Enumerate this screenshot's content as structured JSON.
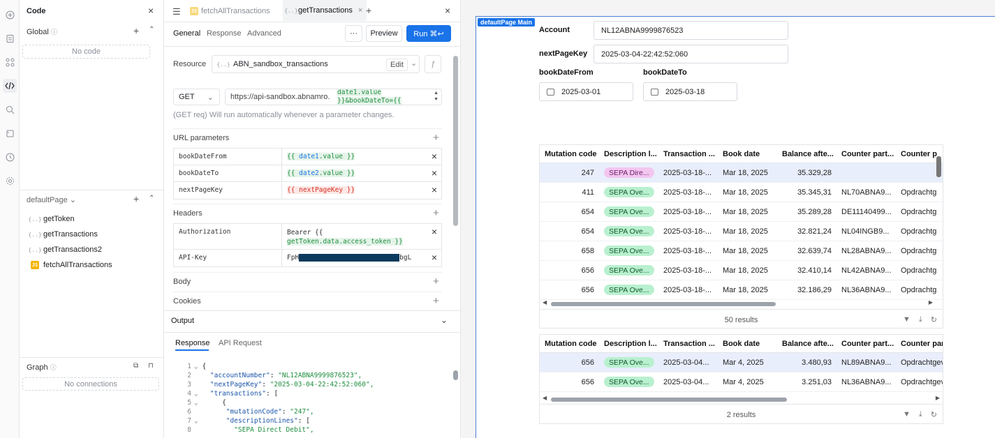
{
  "code_panel": {
    "title": "Code",
    "global_label": "Global",
    "no_code": "No code",
    "page_label": "defaultPage",
    "queries": [
      {
        "name": "getToken",
        "kind": "query"
      },
      {
        "name": "getTransactions",
        "kind": "query"
      },
      {
        "name": "getTransactions2",
        "kind": "query"
      },
      {
        "name": "fetchAllTransactions",
        "kind": "js"
      }
    ],
    "graph_label": "Graph",
    "no_connections": "No connections"
  },
  "editor": {
    "tabs": [
      {
        "label": "fetchAllTransactions",
        "icon": "JS"
      },
      {
        "label": "getTransactions",
        "icon": "{}"
      }
    ],
    "subtabs": [
      "General",
      "Response",
      "Advanced"
    ],
    "more": "···",
    "preview": "Preview",
    "run": "Run ⌘↩",
    "resource_label": "Resource",
    "resource_value": "ABN_sandbox_transactions",
    "edit": "Edit",
    "method": "GET",
    "url_prefix": "https://api-sandbox.abnamro.",
    "url_line1": "date1.value",
    "url_line2": "}}&bookDateTo={{",
    "hint": "(GET req) Will run automatically whenever a parameter changes.",
    "url_params_label": "URL parameters",
    "params": [
      {
        "key": "bookDateFrom",
        "value": "{{ date1.value }}"
      },
      {
        "key": "bookDateTo",
        "value": "{{ date2.value }}"
      },
      {
        "key": "nextPageKey",
        "value": "{{ nextPageKey }}"
      }
    ],
    "headers_label": "Headers",
    "headers": [
      {
        "key": "Authorization",
        "value_line1": "Bearer {{",
        "value_line2": "getToken.data.access_token }}"
      },
      {
        "key": "API-Key",
        "value_prefix": "FpH",
        "value_suffix": "bgL"
      }
    ],
    "body_label": "Body",
    "cookies_label": "Cookies"
  },
  "output": {
    "title": "Output",
    "tabs": [
      "Response",
      "API Request"
    ],
    "lines": [
      {
        "n": "1",
        "text": "{"
      },
      {
        "n": "2",
        "key": "\"accountNumber\"",
        "val": "\"NL12ABNA9999876523\","
      },
      {
        "n": "3",
        "key": "\"nextPageKey\"",
        "val": "\"2025-03-04-22:42:52:060\","
      },
      {
        "n": "4",
        "key": "\"transactions\"",
        "val": "["
      },
      {
        "n": "5",
        "text": "  {"
      },
      {
        "n": "6",
        "key": "\"mutationCode\"",
        "val": "\"247\","
      },
      {
        "n": "7",
        "key": "\"descriptionLines\"",
        "val": "["
      },
      {
        "n": "8",
        "val": "\"SEPA Direct Debit\","
      }
    ]
  },
  "canvas": {
    "frame_label": "defaultPage Main",
    "account_label": "Account",
    "account_value": "NL12ABNA9999876523",
    "nextpage_label": "nextPageKey",
    "nextpage_value": "2025-03-04-22:42:52:060",
    "from_label": "bookDateFrom",
    "from_value": "2025-03-01",
    "to_label": "bookDateTo",
    "to_value": "2025-03-18"
  },
  "table1": {
    "columns": [
      "Mutation code",
      "Description l...",
      "Transaction ...",
      "Book date",
      "Balance afte...",
      "Counter part...",
      "Counter p"
    ],
    "rows": [
      {
        "code": "247",
        "desc": "SEPA Dire...",
        "tag": "pink",
        "tx": "2025-03-18-...",
        "date": "Mar 18, 2025",
        "bal": "35.329,28",
        "cp": "",
        "cpn": ""
      },
      {
        "code": "411",
        "desc": "SEPA Ove...",
        "tag": "green",
        "tx": "2025-03-18-...",
        "date": "Mar 18, 2025",
        "bal": "35.345,31",
        "cp": "NL70ABNA9...",
        "cpn": "Opdrachtg"
      },
      {
        "code": "654",
        "desc": "SEPA Ove...",
        "tag": "green",
        "tx": "2025-03-18-...",
        "date": "Mar 18, 2025",
        "bal": "35.289,28",
        "cp": "DE11140499...",
        "cpn": "Opdrachtg"
      },
      {
        "code": "654",
        "desc": "SEPA Ove...",
        "tag": "green",
        "tx": "2025-03-18-...",
        "date": "Mar 18, 2025",
        "bal": "32.821,24",
        "cp": "NL04INGB9...",
        "cpn": "Opdrachtg"
      },
      {
        "code": "658",
        "desc": "SEPA Ove...",
        "tag": "green",
        "tx": "2025-03-18-...",
        "date": "Mar 18, 2025",
        "bal": "32.639,74",
        "cp": "NL28ABNA9...",
        "cpn": "Opdrachtg"
      },
      {
        "code": "656",
        "desc": "SEPA Ove...",
        "tag": "green",
        "tx": "2025-03-18-...",
        "date": "Mar 18, 2025",
        "bal": "32.410,14",
        "cp": "NL42ABNA9...",
        "cpn": "Opdrachtg"
      },
      {
        "code": "656",
        "desc": "SEPA Ove...",
        "tag": "green",
        "tx": "2025-03-18-...",
        "date": "Mar 18, 2025",
        "bal": "32.186,29",
        "cp": "NL36ABNA9...",
        "cpn": "Opdrachtg"
      }
    ],
    "results": "50 results"
  },
  "table2": {
    "columns": [
      "Mutation code",
      "Description l...",
      "Transaction ...",
      "Book date",
      "Balance afte...",
      "Counter part...",
      "Counter part"
    ],
    "rows": [
      {
        "code": "656",
        "desc": "SEPA Ove...",
        "tag": "green",
        "tx": "2025-03-04...",
        "date": "Mar 4, 2025",
        "bal": "3.480,93",
        "cp": "NL89ABNA9...",
        "cpn": "Opdrachtgev"
      },
      {
        "code": "656",
        "desc": "SEPA Ove...",
        "tag": "green",
        "tx": "2025-03-04...",
        "date": "Mar 4, 2025",
        "bal": "3.251,03",
        "cp": "NL36ABNA9...",
        "cpn": "Opdrachtgev"
      }
    ],
    "results": "2 results"
  },
  "colors": {
    "accent": "#1a73e8",
    "pill_green": "#b9f0cf",
    "pill_pink": "#f3c6f0",
    "frame": "#4a7fd4"
  }
}
